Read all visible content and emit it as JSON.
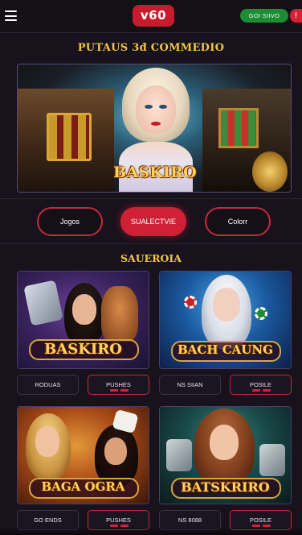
{
  "header": {
    "logo_text": "v60",
    "signup_label": "GOI SIIVO",
    "notif_label": "!"
  },
  "headline": "PUTAUS 3đ COMMEDIO",
  "hero": {
    "title": "BASKIRO"
  },
  "tabs": [
    {
      "label": "Jogos",
      "active": false
    },
    {
      "label": "SUALECTVIE",
      "active": true
    },
    {
      "label": "Colorr",
      "active": false
    }
  ],
  "section_title": "SAUEROIA",
  "games": [
    {
      "title": "BASKIRO",
      "btn_left": "RODUAS",
      "btn_right": "PUSHES"
    },
    {
      "title": "BACH CAUNG",
      "btn_left": "NS SIIAN",
      "btn_right": "POSILE"
    },
    {
      "title": "BAGA OGRA",
      "btn_left": "GO ENDS",
      "btn_right": "PUSHES"
    },
    {
      "title": "BATSKRIRO",
      "btn_left": "NS 8088",
      "btn_right": "POSILE"
    }
  ],
  "colors": {
    "accent": "#cf2035",
    "gold": "#f2c54a",
    "signup_green": "#1d8c35",
    "background": "#17121c"
  },
  "icons": {
    "menu": "hamburger-menu-icon"
  }
}
